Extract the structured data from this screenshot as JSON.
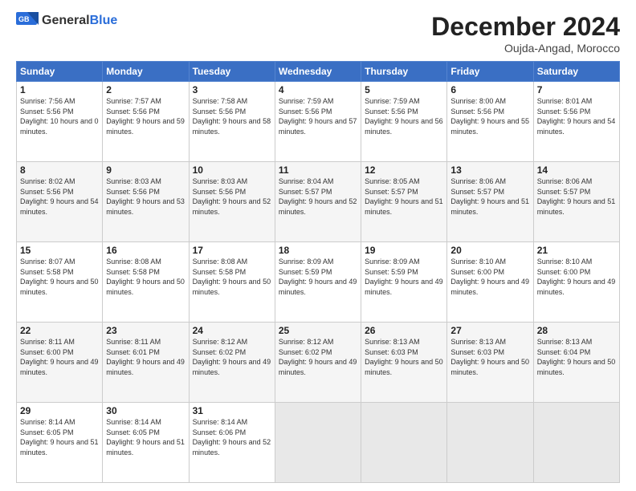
{
  "logo": {
    "text_general": "General",
    "text_blue": "Blue"
  },
  "header": {
    "month_year": "December 2024",
    "location": "Oujda-Angad, Morocco"
  },
  "columns": [
    "Sunday",
    "Monday",
    "Tuesday",
    "Wednesday",
    "Thursday",
    "Friday",
    "Saturday"
  ],
  "weeks": [
    [
      {
        "day": "1",
        "sunrise": "Sunrise: 7:56 AM",
        "sunset": "Sunset: 5:56 PM",
        "daylight": "Daylight: 10 hours and 0 minutes."
      },
      {
        "day": "2",
        "sunrise": "Sunrise: 7:57 AM",
        "sunset": "Sunset: 5:56 PM",
        "daylight": "Daylight: 9 hours and 59 minutes."
      },
      {
        "day": "3",
        "sunrise": "Sunrise: 7:58 AM",
        "sunset": "Sunset: 5:56 PM",
        "daylight": "Daylight: 9 hours and 58 minutes."
      },
      {
        "day": "4",
        "sunrise": "Sunrise: 7:59 AM",
        "sunset": "Sunset: 5:56 PM",
        "daylight": "Daylight: 9 hours and 57 minutes."
      },
      {
        "day": "5",
        "sunrise": "Sunrise: 7:59 AM",
        "sunset": "Sunset: 5:56 PM",
        "daylight": "Daylight: 9 hours and 56 minutes."
      },
      {
        "day": "6",
        "sunrise": "Sunrise: 8:00 AM",
        "sunset": "Sunset: 5:56 PM",
        "daylight": "Daylight: 9 hours and 55 minutes."
      },
      {
        "day": "7",
        "sunrise": "Sunrise: 8:01 AM",
        "sunset": "Sunset: 5:56 PM",
        "daylight": "Daylight: 9 hours and 54 minutes."
      }
    ],
    [
      {
        "day": "8",
        "sunrise": "Sunrise: 8:02 AM",
        "sunset": "Sunset: 5:56 PM",
        "daylight": "Daylight: 9 hours and 54 minutes."
      },
      {
        "day": "9",
        "sunrise": "Sunrise: 8:03 AM",
        "sunset": "Sunset: 5:56 PM",
        "daylight": "Daylight: 9 hours and 53 minutes."
      },
      {
        "day": "10",
        "sunrise": "Sunrise: 8:03 AM",
        "sunset": "Sunset: 5:56 PM",
        "daylight": "Daylight: 9 hours and 52 minutes."
      },
      {
        "day": "11",
        "sunrise": "Sunrise: 8:04 AM",
        "sunset": "Sunset: 5:57 PM",
        "daylight": "Daylight: 9 hours and 52 minutes."
      },
      {
        "day": "12",
        "sunrise": "Sunrise: 8:05 AM",
        "sunset": "Sunset: 5:57 PM",
        "daylight": "Daylight: 9 hours and 51 minutes."
      },
      {
        "day": "13",
        "sunrise": "Sunrise: 8:06 AM",
        "sunset": "Sunset: 5:57 PM",
        "daylight": "Daylight: 9 hours and 51 minutes."
      },
      {
        "day": "14",
        "sunrise": "Sunrise: 8:06 AM",
        "sunset": "Sunset: 5:57 PM",
        "daylight": "Daylight: 9 hours and 51 minutes."
      }
    ],
    [
      {
        "day": "15",
        "sunrise": "Sunrise: 8:07 AM",
        "sunset": "Sunset: 5:58 PM",
        "daylight": "Daylight: 9 hours and 50 minutes."
      },
      {
        "day": "16",
        "sunrise": "Sunrise: 8:08 AM",
        "sunset": "Sunset: 5:58 PM",
        "daylight": "Daylight: 9 hours and 50 minutes."
      },
      {
        "day": "17",
        "sunrise": "Sunrise: 8:08 AM",
        "sunset": "Sunset: 5:58 PM",
        "daylight": "Daylight: 9 hours and 50 minutes."
      },
      {
        "day": "18",
        "sunrise": "Sunrise: 8:09 AM",
        "sunset": "Sunset: 5:59 PM",
        "daylight": "Daylight: 9 hours and 49 minutes."
      },
      {
        "day": "19",
        "sunrise": "Sunrise: 8:09 AM",
        "sunset": "Sunset: 5:59 PM",
        "daylight": "Daylight: 9 hours and 49 minutes."
      },
      {
        "day": "20",
        "sunrise": "Sunrise: 8:10 AM",
        "sunset": "Sunset: 6:00 PM",
        "daylight": "Daylight: 9 hours and 49 minutes."
      },
      {
        "day": "21",
        "sunrise": "Sunrise: 8:10 AM",
        "sunset": "Sunset: 6:00 PM",
        "daylight": "Daylight: 9 hours and 49 minutes."
      }
    ],
    [
      {
        "day": "22",
        "sunrise": "Sunrise: 8:11 AM",
        "sunset": "Sunset: 6:00 PM",
        "daylight": "Daylight: 9 hours and 49 minutes."
      },
      {
        "day": "23",
        "sunrise": "Sunrise: 8:11 AM",
        "sunset": "Sunset: 6:01 PM",
        "daylight": "Daylight: 9 hours and 49 minutes."
      },
      {
        "day": "24",
        "sunrise": "Sunrise: 8:12 AM",
        "sunset": "Sunset: 6:02 PM",
        "daylight": "Daylight: 9 hours and 49 minutes."
      },
      {
        "day": "25",
        "sunrise": "Sunrise: 8:12 AM",
        "sunset": "Sunset: 6:02 PM",
        "daylight": "Daylight: 9 hours and 49 minutes."
      },
      {
        "day": "26",
        "sunrise": "Sunrise: 8:13 AM",
        "sunset": "Sunset: 6:03 PM",
        "daylight": "Daylight: 9 hours and 50 minutes."
      },
      {
        "day": "27",
        "sunrise": "Sunrise: 8:13 AM",
        "sunset": "Sunset: 6:03 PM",
        "daylight": "Daylight: 9 hours and 50 minutes."
      },
      {
        "day": "28",
        "sunrise": "Sunrise: 8:13 AM",
        "sunset": "Sunset: 6:04 PM",
        "daylight": "Daylight: 9 hours and 50 minutes."
      }
    ],
    [
      {
        "day": "29",
        "sunrise": "Sunrise: 8:14 AM",
        "sunset": "Sunset: 6:05 PM",
        "daylight": "Daylight: 9 hours and 51 minutes."
      },
      {
        "day": "30",
        "sunrise": "Sunrise: 8:14 AM",
        "sunset": "Sunset: 6:05 PM",
        "daylight": "Daylight: 9 hours and 51 minutes."
      },
      {
        "day": "31",
        "sunrise": "Sunrise: 8:14 AM",
        "sunset": "Sunset: 6:06 PM",
        "daylight": "Daylight: 9 hours and 52 minutes."
      },
      null,
      null,
      null,
      null
    ]
  ]
}
